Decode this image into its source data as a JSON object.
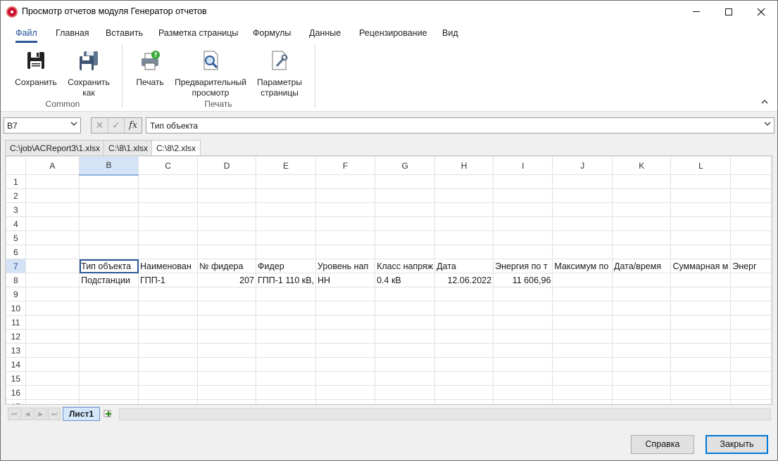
{
  "window": {
    "title": "Просмотр отчетов модуля Генератор отчетов"
  },
  "ribbon": {
    "tabs": [
      "Файл",
      "Главная",
      "Вставить",
      "Разметка страницы",
      "Формулы",
      "Данные",
      "Рецензирование",
      "Вид"
    ],
    "groups": {
      "common": {
        "label": "Common",
        "save": "Сохранить",
        "save_as_1": "Сохранить",
        "save_as_2": "как"
      },
      "print": {
        "label": "Печать",
        "print": "Печать",
        "preview_1": "Предварительный",
        "preview_2": "просмотр",
        "page_setup_1": "Параметры",
        "page_setup_2": "страницы"
      }
    }
  },
  "formula_bar": {
    "name_box": "B7",
    "fx": "fx",
    "value": "Тип объекта"
  },
  "doc_tabs": [
    "C:\\job\\ACReport3\\1.xlsx",
    "C:\\8\\1.xlsx",
    "C:\\8\\2.xlsx"
  ],
  "grid": {
    "columns": [
      "A",
      "B",
      "C",
      "D",
      "E",
      "F",
      "G",
      "H",
      "I",
      "J",
      "K",
      "L",
      ""
    ],
    "row7": [
      "",
      "Тип объекта",
      "Наименован",
      "№ фидера",
      "Фидер",
      "Уровень нап",
      "Класс напряж",
      "Дата",
      "Энергия по т",
      "Максимум по",
      "Дата/время",
      "Суммарная м",
      "Энерг"
    ],
    "row8": [
      "",
      "Подстанции",
      "ГПП-1",
      "207",
      "ГПП-1 110 кВ,",
      "НН",
      "0.4 кВ",
      "12.06.2022",
      "11 606,96",
      "",
      "",
      "",
      ""
    ]
  },
  "sheets": {
    "active": "Лист1"
  },
  "buttons": {
    "help": "Справка",
    "close": "Закрыть"
  }
}
